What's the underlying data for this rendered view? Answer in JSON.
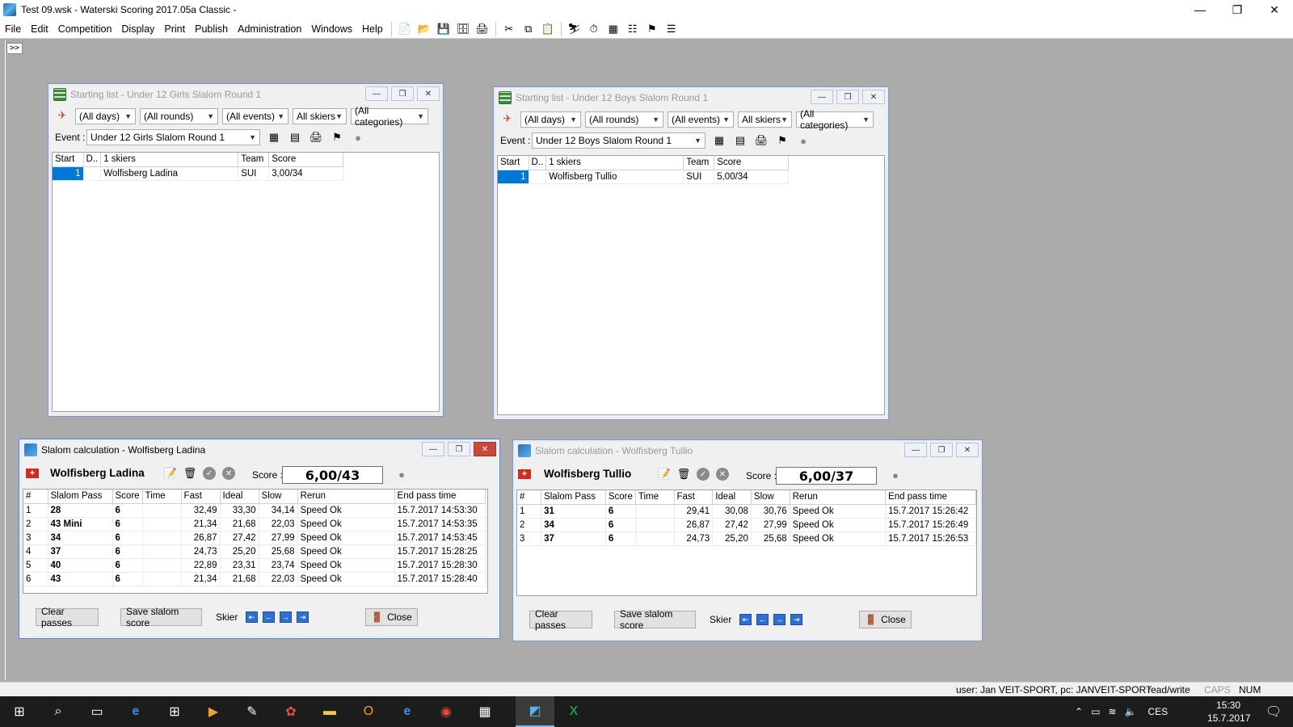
{
  "app": {
    "title": "Test 09.wsk - Waterski Scoring 2017.05a Classic -",
    "controls": {
      "minimize": "—",
      "restore": "❐",
      "close": "✕"
    }
  },
  "menu": [
    "File",
    "Edit",
    "Competition",
    "Display",
    "Print",
    "Publish",
    "Administration",
    "Windows",
    "Help"
  ],
  "mdi_expand": ">>",
  "starting_lists": [
    {
      "title": "Starting list - Under 12 Girls Slalom Round 1",
      "filters": {
        "days": "(All days)",
        "rounds": "(All rounds)",
        "events": "(All events)",
        "skiers": "All skiers",
        "categories": "(All categories)"
      },
      "event_label": "Event :",
      "event_value": "Under 12 Girls Slalom Round 1",
      "columns": [
        "Start",
        "D..",
        "1 skiers",
        "Team",
        "Score"
      ],
      "rows": [
        {
          "start": "1",
          "d": "",
          "name": "Wolfisberg Ladina",
          "team": "SUI",
          "score": "3,00/34"
        }
      ]
    },
    {
      "title": "Starting list - Under 12 Boys Slalom Round 1",
      "filters": {
        "days": "(All days)",
        "rounds": "(All rounds)",
        "events": "(All events)",
        "skiers": "All skiers",
        "categories": "(All categories)"
      },
      "event_label": "Event :",
      "event_value": "Under 12 Boys Slalom Round 1",
      "columns": [
        "Start",
        "D..",
        "1 skiers",
        "Team",
        "Score"
      ],
      "rows": [
        {
          "start": "1",
          "d": "",
          "name": "Wolfisberg Tullio",
          "team": "SUI",
          "score": "5,00/34"
        }
      ]
    }
  ],
  "slalom_calcs": [
    {
      "title": "Slalom calculation - Wolfisberg Ladina",
      "skier": "Wolfisberg Ladina",
      "score_label": "Score :",
      "score": "6,00/43",
      "columns": [
        "#",
        "Slalom Pass",
        "Score",
        "Time",
        "Fast",
        "Ideal",
        "Slow",
        "Rerun",
        "End pass time"
      ],
      "rows": [
        {
          "n": "1",
          "pass": "28",
          "score": "6",
          "time": "",
          "fast": "32,49",
          "ideal": "33,30",
          "slow": "34,14",
          "rerun": "Speed Ok",
          "end": "15.7.2017 14:53:30"
        },
        {
          "n": "2",
          "pass": "43 Mini",
          "score": "6",
          "time": "",
          "fast": "21,34",
          "ideal": "21,68",
          "slow": "22,03",
          "rerun": "Speed Ok",
          "end": "15.7.2017 14:53:35"
        },
        {
          "n": "3",
          "pass": "34",
          "score": "6",
          "time": "",
          "fast": "26,87",
          "ideal": "27,42",
          "slow": "27,99",
          "rerun": "Speed Ok",
          "end": "15.7.2017 14:53:45"
        },
        {
          "n": "4",
          "pass": "37",
          "score": "6",
          "time": "",
          "fast": "24,73",
          "ideal": "25,20",
          "slow": "25,68",
          "rerun": "Speed Ok",
          "end": "15.7.2017 15:28:25"
        },
        {
          "n": "5",
          "pass": "40",
          "score": "6",
          "time": "",
          "fast": "22,89",
          "ideal": "23,31",
          "slow": "23,74",
          "rerun": "Speed Ok",
          "end": "15.7.2017 15:28:30"
        },
        {
          "n": "6",
          "pass": "43",
          "score": "6",
          "time": "",
          "fast": "21,34",
          "ideal": "21,68",
          "slow": "22,03",
          "rerun": "Speed Ok",
          "end": "15.7.2017 15:28:40"
        }
      ],
      "buttons": {
        "clear": "Clear passes",
        "save": "Save slalom score",
        "skier": "Skier",
        "close": "Close"
      }
    },
    {
      "title": "Slalom calculation - Wolfisberg Tullio",
      "skier": "Wolfisberg Tullio",
      "score_label": "Score :",
      "score": "6,00/37",
      "columns": [
        "#",
        "Slalom Pass",
        "Score",
        "Time",
        "Fast",
        "Ideal",
        "Slow",
        "Rerun",
        "End pass time"
      ],
      "rows": [
        {
          "n": "1",
          "pass": "31",
          "score": "6",
          "time": "",
          "fast": "29,41",
          "ideal": "30,08",
          "slow": "30,76",
          "rerun": "Speed Ok",
          "end": "15.7.2017 15:26:42"
        },
        {
          "n": "2",
          "pass": "34",
          "score": "6",
          "time": "",
          "fast": "26,87",
          "ideal": "27,42",
          "slow": "27,99",
          "rerun": "Speed Ok",
          "end": "15.7.2017 15:26:49"
        },
        {
          "n": "3",
          "pass": "37",
          "score": "6",
          "time": "",
          "fast": "24,73",
          "ideal": "25,20",
          "slow": "25,68",
          "rerun": "Speed Ok",
          "end": "15.7.2017 15:26:53"
        }
      ],
      "buttons": {
        "clear": "Clear passes",
        "save": "Save slalom score",
        "skier": "Skier",
        "close": "Close"
      }
    }
  ],
  "status": {
    "user": "user: Jan VEIT-SPORT, pc: JANVEIT-SPORT",
    "mode": "read/write",
    "caps": "CAPS",
    "num": "NUM"
  },
  "taskbar": {
    "lang": "CES",
    "time": "15:30",
    "date": "15.7.2017"
  },
  "colors": {
    "selection": "#0078d7",
    "mdi_bg": "#ababab",
    "taskbar": "#1c1c1c",
    "close_red": "#c94a3d"
  }
}
